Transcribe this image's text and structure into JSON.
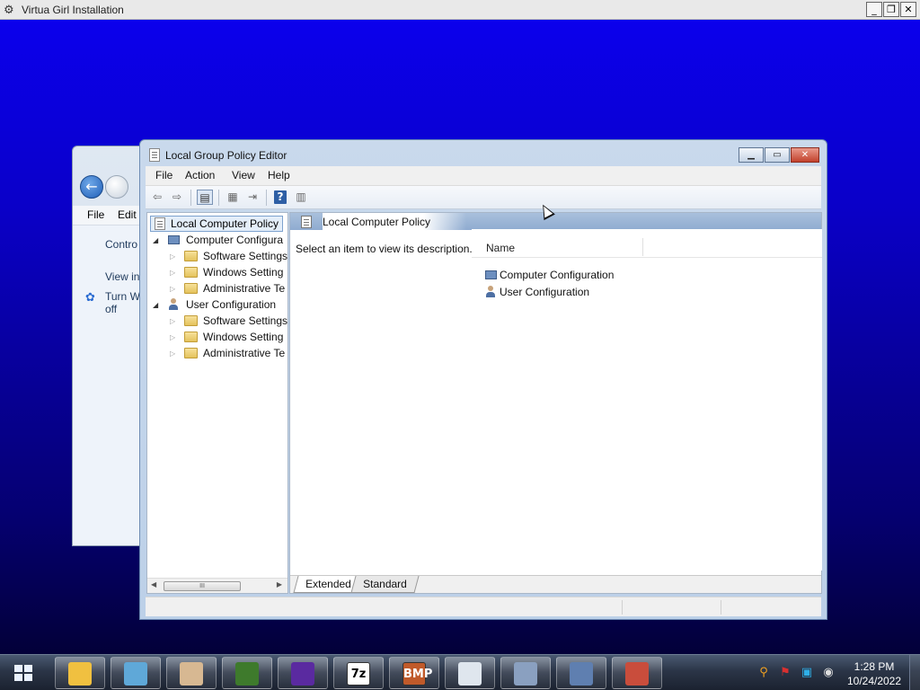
{
  "outer_window": {
    "title": "Virtua Girl Installation",
    "controls": [
      "_",
      "❐",
      "✕"
    ]
  },
  "background_window": {
    "menu": [
      "File",
      "Edit"
    ],
    "side_links": [
      "Contro",
      "View in",
      "Turn W",
      "off"
    ]
  },
  "gpe": {
    "title": "Local Group Policy Editor",
    "menu": [
      "File",
      "Action",
      "View",
      "Help"
    ],
    "tree": {
      "root": "Local Computer Policy",
      "nodes": [
        {
          "label": "Computer Configura",
          "level": 0,
          "expanded": true,
          "icon": "computer-config-icon"
        },
        {
          "label": "Software Settings",
          "level": 1,
          "icon": "folder-icon"
        },
        {
          "label": "Windows Setting",
          "level": 1,
          "icon": "folder-icon"
        },
        {
          "label": "Administrative Te",
          "level": 1,
          "icon": "folder-icon"
        },
        {
          "label": "User Configuration",
          "level": 0,
          "expanded": true,
          "icon": "user-config-icon"
        },
        {
          "label": "Software Settings",
          "level": 1,
          "icon": "folder-icon"
        },
        {
          "label": "Windows Setting",
          "level": 1,
          "icon": "folder-icon"
        },
        {
          "label": "Administrative Te",
          "level": 1,
          "icon": "folder-icon"
        }
      ],
      "scroll_thumb": "III"
    },
    "right": {
      "header": "Local Computer Policy",
      "description": "Select an item to view its description.",
      "column": "Name",
      "items": [
        {
          "label": "Computer Configuration",
          "icon": "computer-config-icon"
        },
        {
          "label": "User Configuration",
          "icon": "user-config-icon"
        }
      ],
      "tabs": [
        "Extended",
        "Standard"
      ]
    }
  },
  "taskbar": {
    "apps": [
      {
        "name": "file-explorer-icon",
        "color": "#f0c040"
      },
      {
        "name": "blocks-app-icon",
        "color": "#5fa8d8"
      },
      {
        "name": "paint-palette-icon",
        "color": "#d7b892"
      },
      {
        "name": "green-box-icon",
        "color": "#3e7a2c"
      },
      {
        "name": "media-player-icon",
        "color": "#5a2aa0"
      },
      {
        "name": "7zip-icon",
        "label": "7z",
        "color": "#ffffff"
      },
      {
        "name": "bmp-icon",
        "label": "BMP",
        "color": "#c05a2a"
      },
      {
        "name": "document-app-icon",
        "color": "#dfe6ee"
      },
      {
        "name": "install-computer-icon",
        "color": "#8aa0c0"
      },
      {
        "name": "disc-app-icon",
        "color": "#5f7fb0"
      },
      {
        "name": "toolbox-icon",
        "color": "#c94d3c"
      }
    ],
    "clock": {
      "time": "1:28 PM",
      "date": "10/24/2022"
    }
  }
}
